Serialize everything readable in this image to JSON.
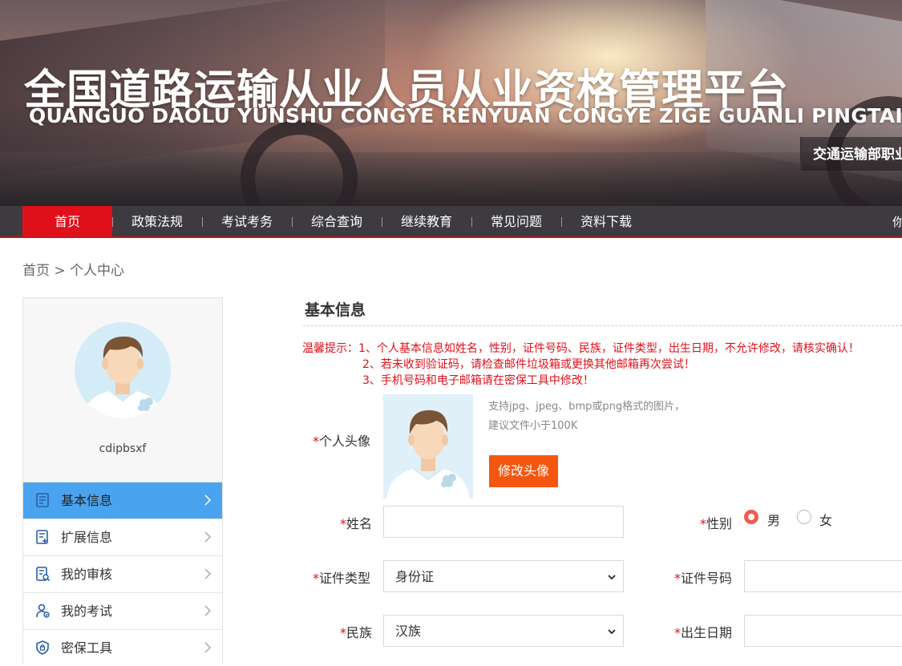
{
  "banner": {
    "title_cn": "全国道路运输从业人员从业资格管理平台",
    "title_en": "QUANGUO DAOLU YUNSHU CONGYE RENYUAN CONGYE ZIGE GUANLI PINGTAI",
    "ministry": "交通运输部职业"
  },
  "nav": {
    "items": [
      "首页",
      "政策法规",
      "考试考务",
      "综合查询",
      "继续教育",
      "常见问题",
      "资料下载"
    ],
    "right_text": "你",
    "active_color": "#e0101a"
  },
  "breadcrumb": "首页 > 个人中心",
  "sidebar": {
    "username": "cdipbsxf",
    "menu": [
      {
        "label": "基本信息",
        "icon": "document-icon"
      },
      {
        "label": "扩展信息",
        "icon": "document-add-icon"
      },
      {
        "label": "我的审核",
        "icon": "audit-icon"
      },
      {
        "label": "我的考试",
        "icon": "user-exam-icon"
      },
      {
        "label": "密保工具",
        "icon": "shield-icon"
      }
    ],
    "active_color": "#4aa3ee"
  },
  "main": {
    "section_title": "基本信息",
    "tips": [
      "温馨提示：1、个人基本信息如姓名，性别，证件号码、民族，证件类型，出生日期，不允许修改，请核实确认！",
      "2、若未收到验证码，请检查邮件垃圾箱或更换其他邮箱再次尝试！",
      "3、手机号码和电子邮箱请在密保工具中修改！"
    ],
    "required_mark": "*",
    "avatar_label": "个人头像",
    "avatar_hint_1": "支持jpg、jpeg、bmp或png格式的图片，",
    "avatar_hint_2": "建议文件小于100K",
    "avatar_button": "修改头像",
    "name_label": "姓名",
    "name_value": "",
    "gender_label": "性别",
    "gender_male": "男",
    "gender_female": "女",
    "gender_selected": "男",
    "id_type_label": "证件类型",
    "id_type_value": "身份证",
    "id_number_label": "证件号码",
    "id_number_value": "",
    "ethnicity_label": "民族",
    "ethnicity_value": "汉族",
    "birthdate_label": "出生日期",
    "birthdate_value": ""
  }
}
